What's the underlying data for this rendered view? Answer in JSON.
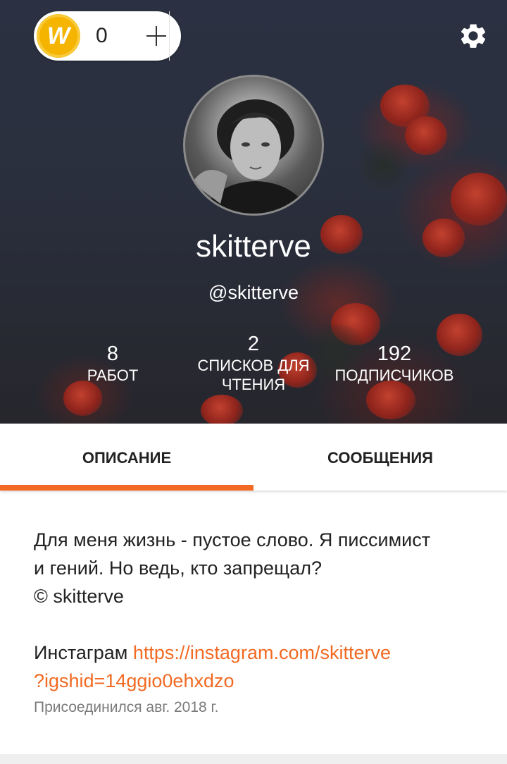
{
  "wallet": {
    "coins": "0",
    "coin_letter": "W"
  },
  "profile": {
    "username": "skitterve",
    "handle": "@skitterve",
    "stats": [
      {
        "value": "8",
        "label": "РАБОТ"
      },
      {
        "value": "2",
        "label": "СПИСКОВ ДЛЯ ЧТЕНИЯ"
      },
      {
        "value": "192",
        "label": "ПОДПИСЧИКОВ"
      }
    ]
  },
  "tabs": [
    {
      "label": "ОПИСАНИЕ",
      "active": true
    },
    {
      "label": "СООБЩЕНИЯ",
      "active": false
    }
  ],
  "about": {
    "bio_line1": "Для меня жизнь - пустое слово. Я писсимист",
    "bio_line2": "и гений. Но ведь, кто запрещал?",
    "bio_line3": "© skitterve",
    "instagram_label": "Инстаграм",
    "instagram_link_line1": "https://instagram.com/skitterve",
    "instagram_link_line2": "?igshid=14ggio0ehxdzo",
    "joined": "Присоединился авг. 2018 г."
  },
  "colors": {
    "accent": "#f26a23",
    "coin": "#f5b400"
  },
  "icons": [
    "coin-icon",
    "plus-icon",
    "gear-icon"
  ]
}
